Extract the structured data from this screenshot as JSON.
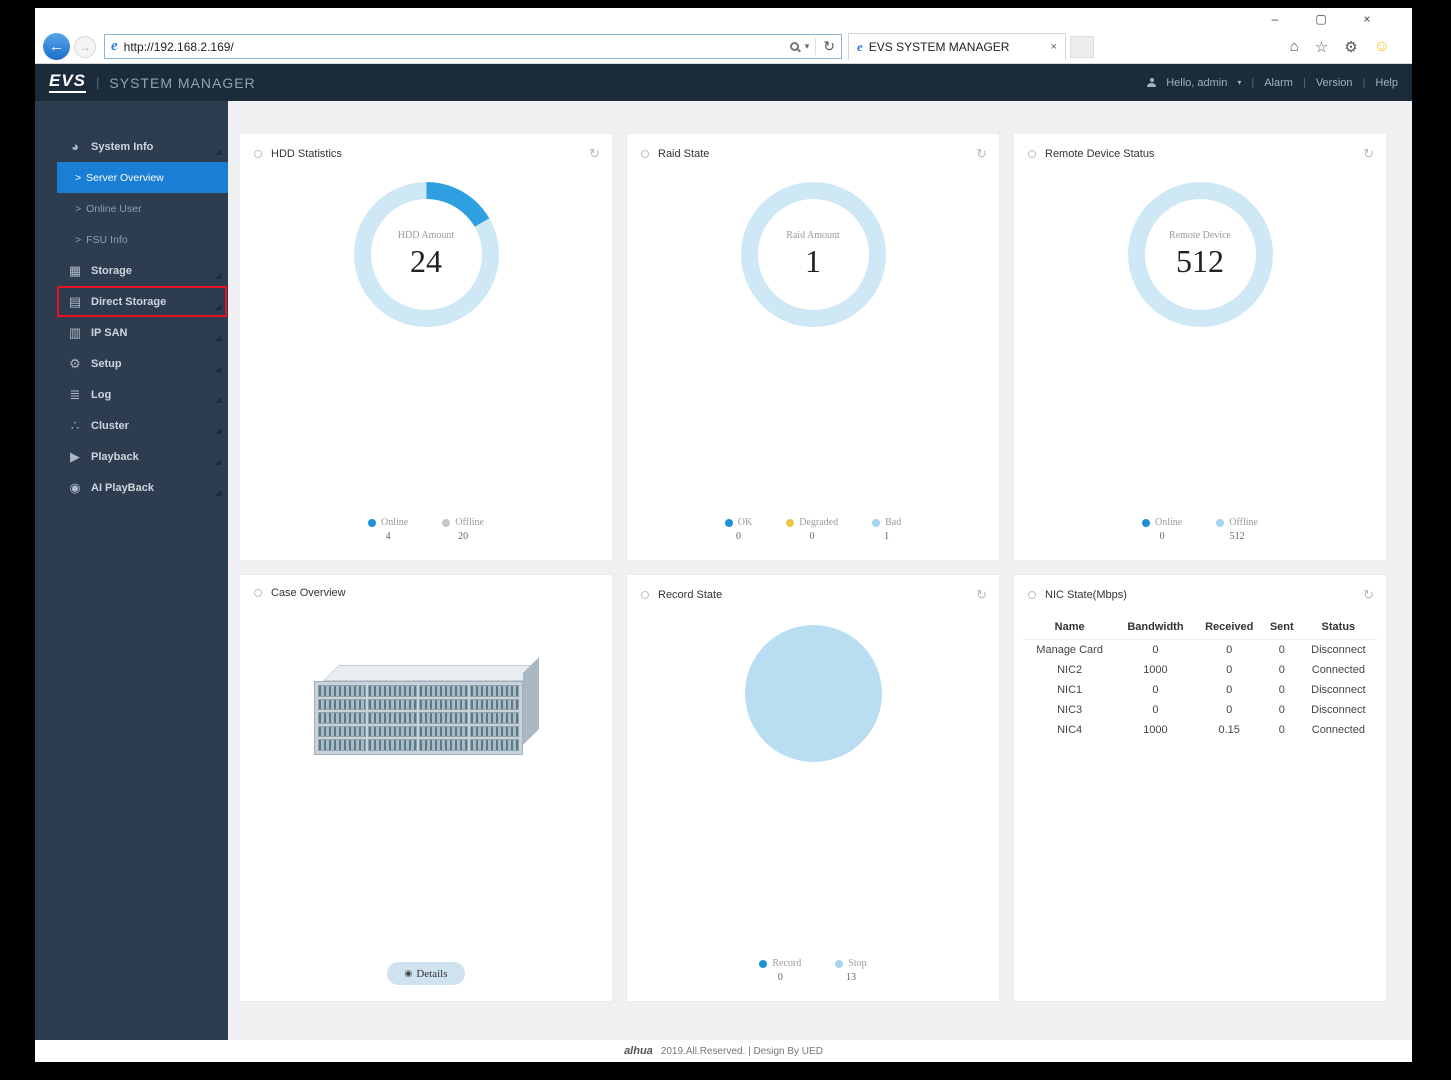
{
  "colors": {
    "accent_blue": "#1a7fd4",
    "donut_blue": "#2e9fe0",
    "donut_light": "#cfe8f6",
    "legend_grey": "#c9c9c9",
    "degraded_yellow": "#f0c64a",
    "record_fill": "#b9ddf1",
    "sidebar_bg": "#2d3c4f",
    "header_bg": "#1c2b3a",
    "annotation_red": "#e81123",
    "smiley_yellow": "#f1c40f"
  },
  "icons": {
    "minimize": "–",
    "maximize": "▢",
    "close": "×",
    "back": "←",
    "forward": "→",
    "ie": "e",
    "caret": "▾",
    "refresh": "↻",
    "home": "⌂",
    "star": "☆",
    "gear": "⚙",
    "smiley": "☺",
    "tab_close": "×",
    "chevron": "◢",
    "eye": "◉"
  },
  "browser": {
    "url": "http://192.168.2.169/",
    "tab_title": "EVS SYSTEM MANAGER"
  },
  "header": {
    "logo": "EVS",
    "divider": "|",
    "title": "SYSTEM MANAGER",
    "greeting": "Hello, admin",
    "sep": "|",
    "links": [
      "Alarm",
      "Version",
      "Help"
    ]
  },
  "sidebar": {
    "sub_prefix": ">",
    "items": [
      {
        "label": "System Info",
        "icon": "◕"
      },
      {
        "label": "Storage",
        "icon": "▦"
      },
      {
        "label": "Direct Storage",
        "icon": "▤"
      },
      {
        "label": "IP SAN",
        "icon": "▥"
      },
      {
        "label": "Setup",
        "icon": "⚙"
      },
      {
        "label": "Log",
        "icon": "≣"
      },
      {
        "label": "Cluster",
        "icon": "∴"
      },
      {
        "label": "Playback",
        "icon": "▶"
      },
      {
        "label": "AI PlayBack",
        "icon": "◉"
      }
    ],
    "system_info_children": [
      {
        "label": "Server Overview"
      },
      {
        "label": "Online User"
      },
      {
        "label": "FSU Info"
      }
    ]
  },
  "panels": {
    "hdd": {
      "title": "HDD Statistics",
      "center_label": "HDD Amount",
      "center_value": "24",
      "legend": [
        {
          "label": "Online",
          "value": "4"
        },
        {
          "label": "Offline",
          "value": "20"
        }
      ]
    },
    "raid": {
      "title": "Raid State",
      "center_label": "Raid Amount",
      "center_value": "1",
      "legend": [
        {
          "label": "OK",
          "value": "0"
        },
        {
          "label": "Degraded",
          "value": "0"
        },
        {
          "label": "Bad",
          "value": "1"
        }
      ]
    },
    "remote": {
      "title": "Remote Device Status",
      "center_label": "Remote Device",
      "center_value": "512",
      "legend": [
        {
          "label": "Online",
          "value": "0"
        },
        {
          "label": "Offline",
          "value": "512"
        }
      ]
    },
    "case": {
      "title": "Case Overview",
      "details": "Details"
    },
    "record": {
      "title": "Record State",
      "legend": [
        {
          "label": "Record",
          "value": "0"
        },
        {
          "label": "Stop",
          "value": "13"
        }
      ]
    },
    "nic": {
      "title": "NIC State(Mbps)",
      "columns": [
        "Name",
        "Bandwidth",
        "Received",
        "Sent",
        "Status"
      ],
      "rows": [
        [
          "Manage Card",
          "0",
          "0",
          "0",
          "Disconnect"
        ],
        [
          "NIC2",
          "1000",
          "0",
          "0",
          "Connected"
        ],
        [
          "NIC1",
          "0",
          "0",
          "0",
          "Disconnect"
        ],
        [
          "NIC3",
          "0",
          "0",
          "0",
          "Disconnect"
        ],
        [
          "NIC4",
          "1000",
          "0.15",
          "0",
          "Connected"
        ]
      ]
    }
  },
  "footer": {
    "logo": "alhua",
    "text": "2019.All.Reserved. | Design By UED"
  },
  "chart_data": [
    {
      "type": "pie",
      "title": "HDD Statistics",
      "categories": [
        "Online",
        "Offline"
      ],
      "values": [
        4,
        20
      ],
      "center_label": "HDD Amount",
      "center_value": 24
    },
    {
      "type": "pie",
      "title": "Raid State",
      "categories": [
        "OK",
        "Degraded",
        "Bad"
      ],
      "values": [
        0,
        0,
        1
      ],
      "center_label": "Raid Amount",
      "center_value": 1
    },
    {
      "type": "pie",
      "title": "Remote Device Status",
      "categories": [
        "Online",
        "Offline"
      ],
      "values": [
        0,
        512
      ],
      "center_label": "Remote Device",
      "center_value": 512
    },
    {
      "type": "pie",
      "title": "Record State",
      "categories": [
        "Record",
        "Stop"
      ],
      "values": [
        0,
        13
      ]
    }
  ]
}
